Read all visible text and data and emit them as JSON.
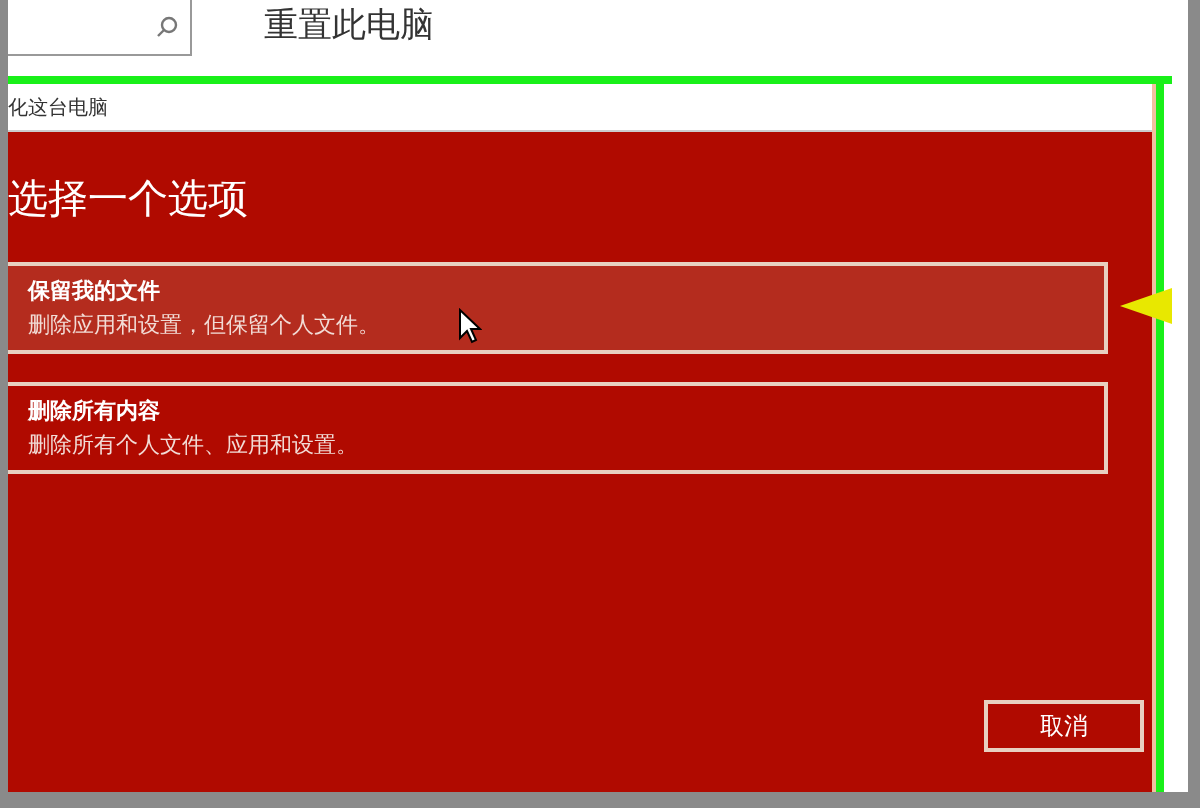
{
  "page_title": "重置此电脑",
  "dialog": {
    "title": "化这台电脑",
    "heading": "选择一个选项",
    "options": [
      {
        "title": "保留我的文件",
        "description": "删除应用和设置，但保留个人文件。",
        "selected": true
      },
      {
        "title": "删除所有内容",
        "description": "删除所有个人文件、应用和设置。",
        "selected": false
      }
    ],
    "buttons": [
      "取消"
    ]
  }
}
